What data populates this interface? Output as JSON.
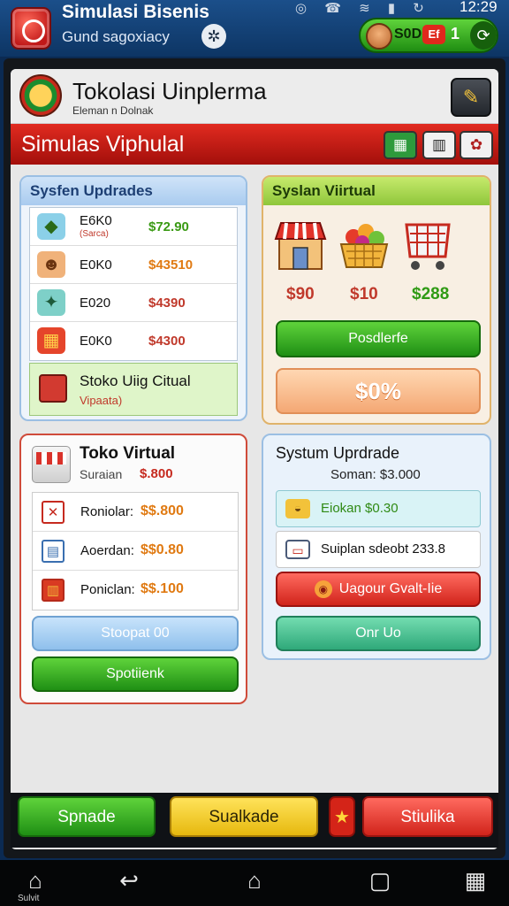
{
  "app": {
    "title": "Simulasi Bisenis",
    "subtitle": "Gund sagoxiacy",
    "coins_text": "S0D",
    "badge_text": "Ef",
    "count": "1",
    "status_time": "12:29"
  },
  "store": {
    "title": "Tokolasi Uinplerma",
    "subtitle": "Eleman n Dolnak",
    "banner_title": "Simulas Viphulal"
  },
  "system_upgrades": {
    "title": "Sysfen Updrades",
    "items": [
      {
        "name": "E6K0",
        "note": "(Sarca)",
        "price": "$72.90",
        "price_color": "#3a9a14",
        "icon": "coins-icon"
      },
      {
        "name": "E0K0",
        "note": "",
        "price": "$43510",
        "price_color": "#e07a12",
        "icon": "farmer-icon"
      },
      {
        "name": "E020",
        "note": "",
        "price": "$4390",
        "price_color": "#c0392b",
        "icon": "cash-icon"
      },
      {
        "name": "E0K0",
        "note": "",
        "price": "$4300",
        "price_color": "#c0392b",
        "icon": "basket-icon"
      }
    ],
    "featured": {
      "title": "Stoko Uiig Citual",
      "subtitle": "Vipaata)"
    }
  },
  "system_virtual": {
    "title": "Syslan Viirtual",
    "items": [
      {
        "icon": "shop-icon",
        "price": "$90",
        "price_color": "#c0392b"
      },
      {
        "icon": "fruit-basket-icon",
        "price": "$10",
        "price_color": "#c0392b"
      },
      {
        "icon": "cart-icon",
        "price": "$288",
        "price_color": "#2f9a14"
      }
    ],
    "primary_button": "Posdlerfe",
    "percent_button": "$0%"
  },
  "toko_virtual": {
    "title": "Toko Virtual",
    "sub_label": "Suraian",
    "sub_value": "$.800",
    "rows": [
      {
        "label": "Roniolar:",
        "price": "$$.800",
        "icon": "x-box-icon"
      },
      {
        "label": "Aoerdan:",
        "price": "$$0.80",
        "icon": "tablet-icon"
      },
      {
        "label": "Poniclan:",
        "price": "$$.100",
        "icon": "crate-icon"
      }
    ],
    "blue_button": "Stoopat 00",
    "green_button": "Spotiienk"
  },
  "system_upgrade": {
    "title": "Systum Uprdrade",
    "sub": "Soman: $3.000",
    "rows": [
      {
        "label": "Eiokan $0.30",
        "style": "highlight",
        "icon": "pot-icon"
      },
      {
        "label": "Suiplan sdeobt 233.8",
        "style": "plain",
        "icon": "frame-icon"
      }
    ],
    "red_button": "Uagour Gvalt-Iie",
    "teal_button": "Onr Uo"
  },
  "bottom_actions": {
    "left": "Spnade",
    "middle": "Sualkade",
    "right": "Stiulika"
  },
  "nav": {
    "home_label": "Sulvit"
  },
  "colors": {
    "brand_red": "#c72a1b",
    "accent_green": "#2f9a14",
    "app_bar_blue": "#0d3564"
  }
}
